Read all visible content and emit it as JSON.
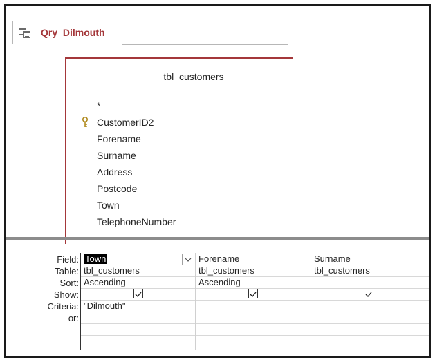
{
  "tab": {
    "title": "Qry_Dilmouth",
    "icon": "query-icon",
    "accent": "#a4373a"
  },
  "table_box": {
    "title": "tbl_customers",
    "fields": [
      "*",
      "CustomerID2",
      "Forename",
      "Surname",
      "Address",
      "Postcode",
      "Town",
      "TelephoneNumber"
    ],
    "primary_key": "CustomerID2"
  },
  "grid": {
    "row_labels": {
      "field": "Field:",
      "table": "Table:",
      "sort": "Sort:",
      "show": "Show:",
      "criteria": "Criteria:",
      "or": "or:"
    },
    "columns": [
      {
        "field": "Town",
        "table": "tbl_customers",
        "sort": "Ascending",
        "show": true,
        "criteria": "\"Dilmouth\""
      },
      {
        "field": "Forename",
        "table": "tbl_customers",
        "sort": "Ascending",
        "show": true,
        "criteria": ""
      },
      {
        "field": "Surname",
        "table": "tbl_customers",
        "sort": "",
        "show": true,
        "criteria": ""
      }
    ]
  }
}
